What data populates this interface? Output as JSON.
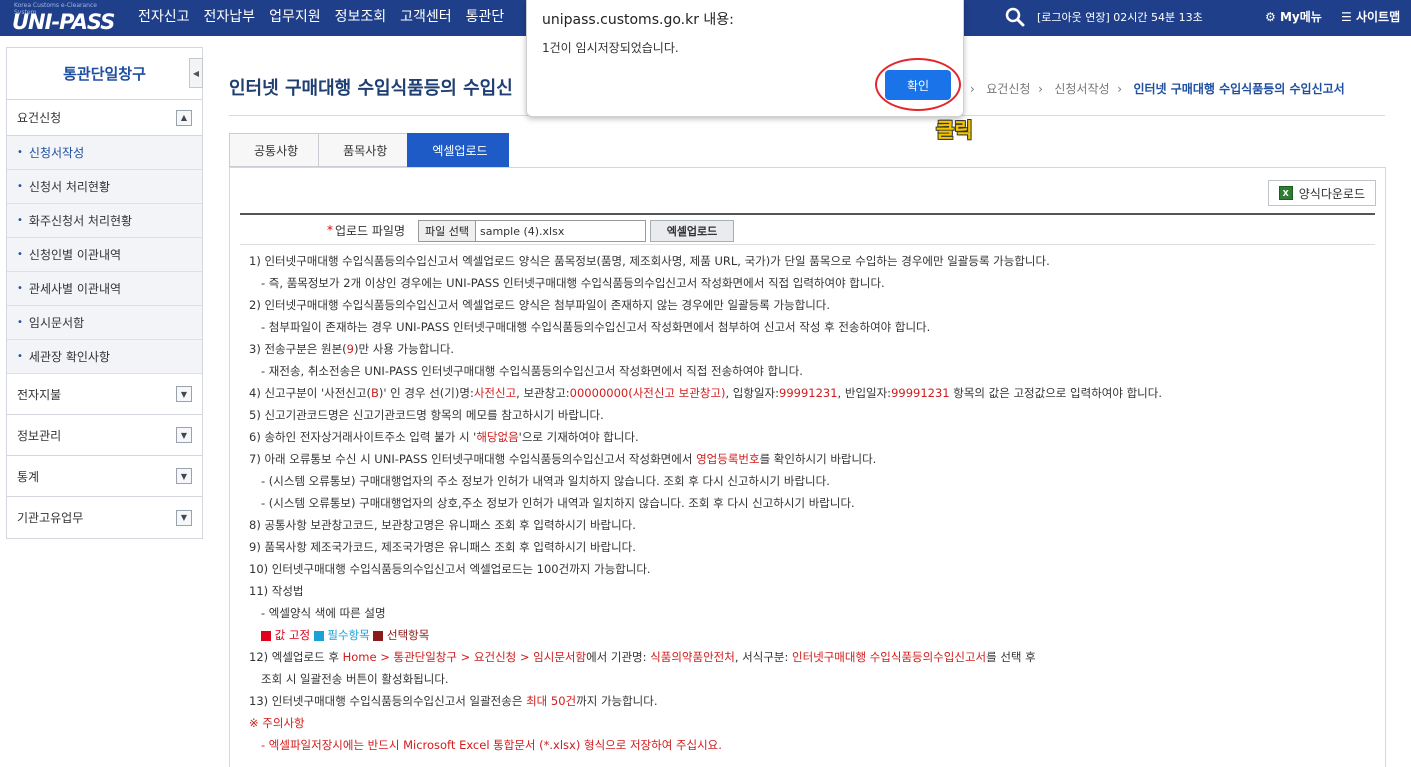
{
  "header": {
    "logo_small": "Korea Customs e-Clearance System",
    "logo_text": "UNI-PASS",
    "nav": [
      "전자신고",
      "전자납부",
      "업무지원",
      "정보조회",
      "고객센터",
      "통관단"
    ],
    "session_text": "[로그아웃 연장] 02시간 54분 13초",
    "my_menu": "My메뉴",
    "sitemap": "사이트맵"
  },
  "sidebar": {
    "title": "통관단일창구",
    "group_open": "요건신청",
    "sub_items": [
      "신청서작성",
      "신청서 처리현황",
      "화주신청서 처리현황",
      "신청인별 이관내역",
      "관세사별 이관내역",
      "임시문서함",
      "세관장 확인사항"
    ],
    "groups_closed": [
      "전자지불",
      "정보관리",
      "통계",
      "기관고유업무"
    ]
  },
  "main": {
    "page_title": "인터넷 구매대행 수입식품등의 수입신",
    "breadcrumb": [
      "요건신청",
      "신청서작성"
    ],
    "breadcrumb_current": "인터넷 구매대행 수입식품등의 수입신고서",
    "tabs": [
      "공통사항",
      "품목사항",
      "엑셀업로드"
    ],
    "form_download": "양식다운로드",
    "upload_label": "업로드 파일명",
    "file_button": "파일 선택",
    "file_name": "sample (4).xlsx",
    "excel_upload": "엑셀업로드"
  },
  "notes": {
    "n1": "1) 인터넷구매대행 수입식품등의수입신고서 엑셀업로드 양식은 품목정보(품명, 제조회사명, 제품 URL, 국가)가 단일 품목으로 수입하는 경우에만 일괄등록 가능합니다.",
    "n1a": "- 즉, 품목정보가 2개 이상인 경우에는 UNI-PASS 인터넷구매대행 수입식품등의수입신고서 작성화면에서 직접 입력하여야 합니다.",
    "n2": "2) 인터넷구매대행 수입식품등의수입신고서 엑셀업로드 양식은 첨부파일이 존재하지 않는 경우에만 일괄등록 가능합니다.",
    "n2a": "- 첨부파일이 존재하는 경우 UNI-PASS 인터넷구매대행 수입식품등의수입신고서 작성화면에서 첨부하여 신고서 작성 후 전송하여야 합니다.",
    "n3_pre": "3) 전송구분은 원본(",
    "n3_red": "9",
    "n3_post": ")만 사용 가능합니다.",
    "n3a": "- 재전송, 취소전송은 UNI-PASS 인터넷구매대행 수입식품등의수입신고서 작성화면에서 직접 전송하여야 합니다.",
    "n4_a": "4) 신고구분이 '사전신고(",
    "n4_b": "B",
    "n4_c": ")' 인 경우 선(기)명:",
    "n4_d": "사전신고",
    "n4_e": ", 보관창고:",
    "n4_f": "00000000(사전신고 보관창고)",
    "n4_g": ", 입항일자:",
    "n4_h": "99991231",
    "n4_i": ", 반입일자:",
    "n4_j": "99991231",
    "n4_k": " 항목의 값은 고정값으로 입력하여야 합니다.",
    "n5": "5) 신고기관코드명은 신고기관코드명 항목의 메모를 참고하시기 바랍니다.",
    "n6_pre": "6) 송하인 전자상거래사이트주소 입력 불가 시 '",
    "n6_red": "해당없음",
    "n6_post": "'으로 기재하여야 합니다.",
    "n7_pre": "7) 아래 오류통보 수신 시 UNI-PASS 인터넷구매대행 수입식품등의수입신고서 작성화면에서 ",
    "n7_red": "영업등록번호",
    "n7_post": "를 확인하시기 바랍니다.",
    "n7a": "- (시스템 오류통보) 구매대행업자의 주소 정보가 인허가 내역과 일치하지 않습니다. 조회 후 다시 신고하시기 바랍니다.",
    "n7b": "- (시스템 오류통보) 구매대행업자의 상호,주소 정보가 인허가 내역과 일치하지 않습니다. 조회 후 다시 신고하시기 바랍니다.",
    "n8": "8) 공통사항 보관창고코드, 보관창고명은 유니패스 조회 후 입력하시기 바랍니다.",
    "n9": "9) 품목사항 제조국가코드, 제조국가명은 유니패스 조회 후 입력하시기 바랍니다.",
    "n10": "10) 인터넷구매대행 수입식품등의수입신고서 엑셀업로드는 100건까지 가능합니다.",
    "n11": "11) 작성법",
    "n11a": "- 엑셀양식 색에 따른 설명",
    "legend_fixed": "값 고정",
    "legend_required": "필수항목",
    "legend_optional": "선택항목",
    "n12_a": "12) 엑셀업로드 후 ",
    "n12_b": "Home > 통관단일창구 > 요건신청 > 임시문서함",
    "n12_c": "에서 기관명: ",
    "n12_d": "식품의약품안전처",
    "n12_e": ", 서식구분: ",
    "n12_f": "인터넷구매대행 수입식품등의수입신고서",
    "n12_g": "를 선택 후",
    "n12a": "조회 시 일괄전송 버튼이 활성화됩니다.",
    "n13_pre": "13) 인터넷구매대행 수입식품등의수입신고서 일괄전송은 ",
    "n13_red": "최대 50건",
    "n13_post": "까지 가능합니다.",
    "caution": "※ 주의사항",
    "caution_a": "- 엑셀파일저장시에는 반드시 Microsoft Excel 통합문서 (*.xlsx) 형식으로 저장하여 주십시요."
  },
  "dialog": {
    "host": "unipass.customs.go.kr 내용:",
    "message": "1건이 임시저장되었습니다.",
    "ok": "확인"
  },
  "annotation": {
    "click_label": "클릭"
  },
  "colors": {
    "header_bg": "#1f3f8a",
    "active_tab": "#1f5bc7",
    "ok_button": "#1a73e8",
    "annotation_circle": "#e3272d",
    "annotation_text": "#f2c500"
  }
}
